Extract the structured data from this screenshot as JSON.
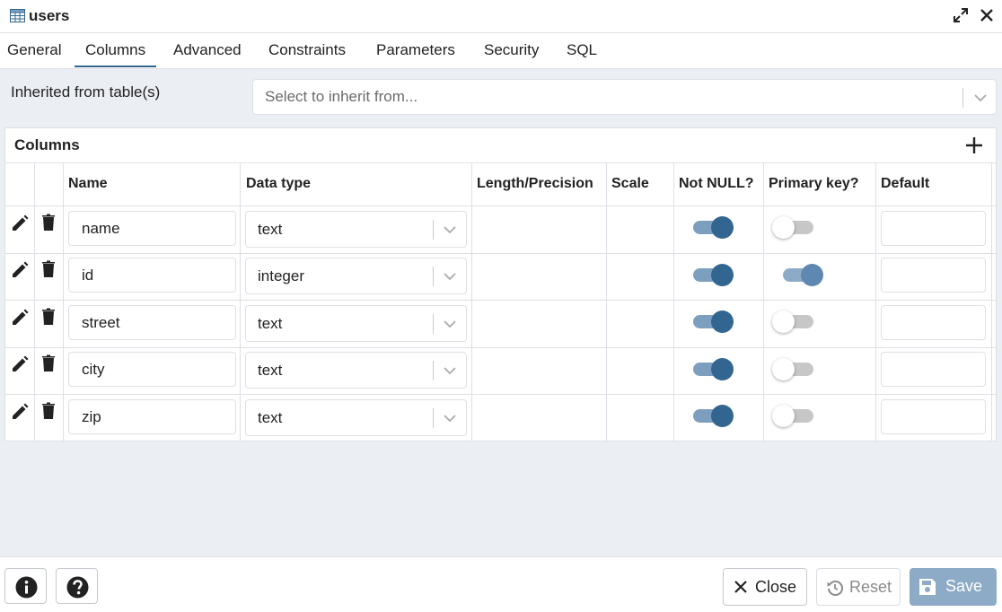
{
  "window": {
    "title": "users"
  },
  "tabs": [
    {
      "label": "General"
    },
    {
      "label": "Columns"
    },
    {
      "label": "Advanced"
    },
    {
      "label": "Constraints"
    },
    {
      "label": "Parameters"
    },
    {
      "label": "Security"
    },
    {
      "label": "SQL"
    }
  ],
  "active_tab": "Columns",
  "inherit": {
    "label": "Inherited from table(s)",
    "placeholder": "Select to inherit from..."
  },
  "columns_panel": {
    "title": "Columns",
    "headers": {
      "name": "Name",
      "data_type": "Data type",
      "length": "Length/Precision",
      "scale": "Scale",
      "not_null": "Not NULL?",
      "primary_key": "Primary key?",
      "default": "Default"
    },
    "rows": [
      {
        "name": "name",
        "data_type": "text",
        "not_null": true,
        "primary_key": false,
        "default": ""
      },
      {
        "name": "id",
        "data_type": "integer",
        "not_null": true,
        "primary_key": true,
        "default": ""
      },
      {
        "name": "street",
        "data_type": "text",
        "not_null": true,
        "primary_key": false,
        "default": ""
      },
      {
        "name": "city",
        "data_type": "text",
        "not_null": true,
        "primary_key": false,
        "default": ""
      },
      {
        "name": "zip",
        "data_type": "text",
        "not_null": true,
        "primary_key": false,
        "default": ""
      }
    ]
  },
  "footer": {
    "close_label": "Close",
    "reset_label": "Reset",
    "save_label": "Save"
  },
  "colors": {
    "accent": "#326690",
    "save_bg": "#8daac6",
    "panel_bg": "#ebeef3"
  },
  "icons": [
    "table-icon",
    "expand-icon",
    "close-icon",
    "add-icon",
    "edit-icon",
    "delete-icon",
    "chevron-down-icon",
    "info-icon",
    "help-icon",
    "reset-icon",
    "save-icon"
  ]
}
